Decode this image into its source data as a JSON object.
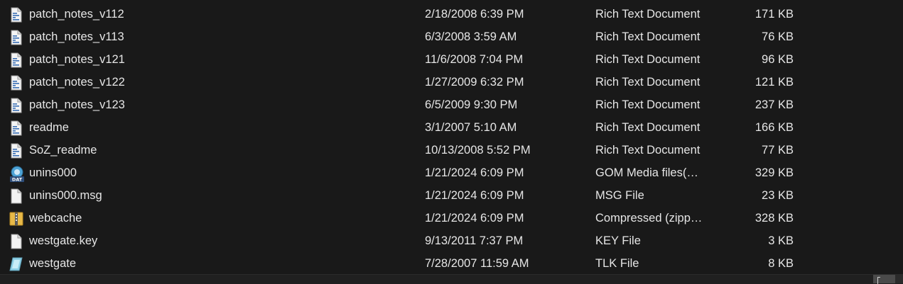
{
  "files": [
    {
      "name": "patch_notes_v112",
      "date": "2/18/2008 6:39 PM",
      "type": "Rich Text Document",
      "size": "171 KB",
      "icon": "rtf-document-icon"
    },
    {
      "name": "patch_notes_v113",
      "date": "6/3/2008 3:59 AM",
      "type": "Rich Text Document",
      "size": "76 KB",
      "icon": "rtf-document-icon"
    },
    {
      "name": "patch_notes_v121",
      "date": "11/6/2008 7:04 PM",
      "type": "Rich Text Document",
      "size": "96 KB",
      "icon": "rtf-document-icon"
    },
    {
      "name": "patch_notes_v122",
      "date": "1/27/2009 6:32 PM",
      "type": "Rich Text Document",
      "size": "121 KB",
      "icon": "rtf-document-icon"
    },
    {
      "name": "patch_notes_v123",
      "date": "6/5/2009 9:30 PM",
      "type": "Rich Text Document",
      "size": "237 KB",
      "icon": "rtf-document-icon"
    },
    {
      "name": "readme",
      "date": "3/1/2007 5:10 AM",
      "type": "Rich Text Document",
      "size": "166 KB",
      "icon": "rtf-document-icon"
    },
    {
      "name": "SoZ_readme",
      "date": "10/13/2008 5:52 PM",
      "type": "Rich Text Document",
      "size": "77 KB",
      "icon": "rtf-document-icon"
    },
    {
      "name": "unins000",
      "date": "1/21/2024 6:09 PM",
      "type": "GOM Media files(…",
      "size": "329 KB",
      "icon": "dat-file-icon",
      "icon_label": "DAT"
    },
    {
      "name": "unins000.msg",
      "date": "1/21/2024 6:09 PM",
      "type": "MSG File",
      "size": "23 KB",
      "icon": "blank-file-icon"
    },
    {
      "name": "webcache",
      "date": "1/21/2024 6:09 PM",
      "type": "Compressed (zipp…",
      "size": "328 KB",
      "icon": "zip-folder-icon"
    },
    {
      "name": "westgate.key",
      "date": "9/13/2011 7:37 PM",
      "type": "KEY File",
      "size": "3 KB",
      "icon": "blank-file-icon"
    },
    {
      "name": "westgate",
      "date": "7/28/2007 11:59 AM",
      "type": "TLK File",
      "size": "8 KB",
      "icon": "tlk-file-icon"
    }
  ],
  "colors": {
    "background": "#191919",
    "text": "#e6e6e6"
  },
  "statusbar": {
    "view_buttons": [
      "details-view-icon",
      "tiles-view-icon"
    ]
  }
}
